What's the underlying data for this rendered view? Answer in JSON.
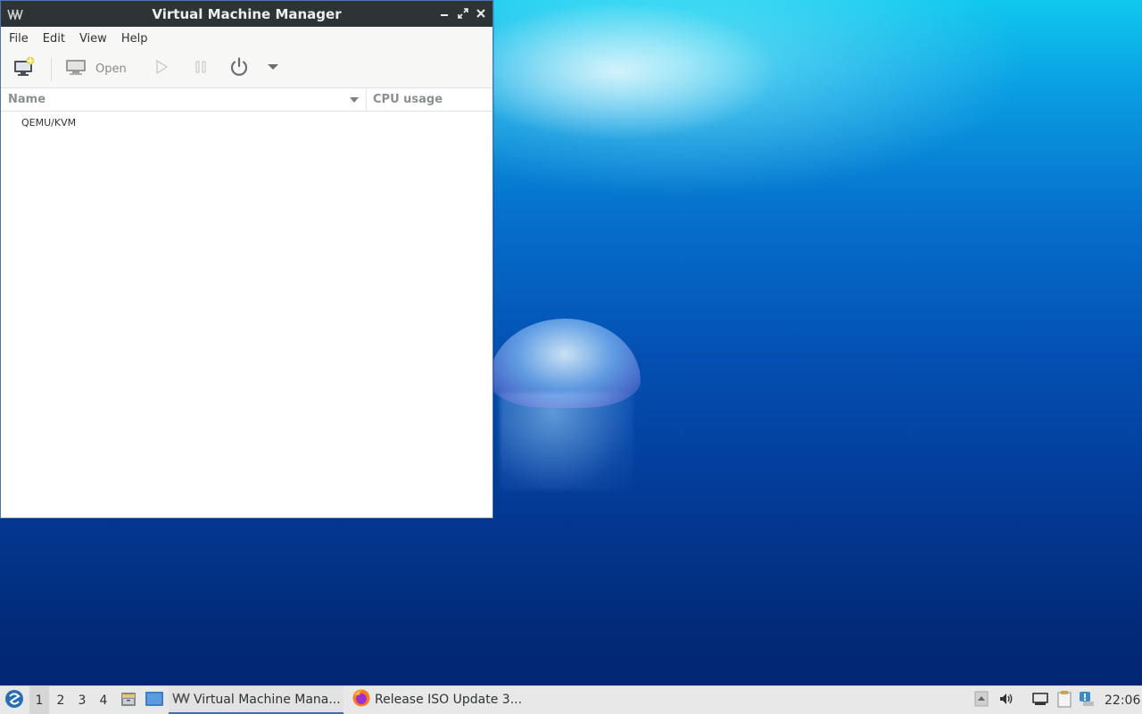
{
  "window": {
    "title": "Virtual Machine Manager",
    "app_icon_text": "VM"
  },
  "menubar": {
    "items": [
      "File",
      "Edit",
      "View",
      "Help"
    ]
  },
  "toolbar": {
    "open_label": "Open"
  },
  "table": {
    "columns": [
      "Name",
      "CPU usage"
    ],
    "rows": [
      {
        "name": "QEMU/KVM",
        "cpu": ""
      }
    ]
  },
  "taskbar": {
    "workspaces": [
      "1",
      "2",
      "3",
      "4"
    ],
    "active_workspace": "1",
    "tasks": [
      {
        "label": "Virtual Machine Mana...",
        "icon": "virt-manager-icon",
        "active": true
      },
      {
        "label": "Release ISO Update 3...",
        "icon": "firefox-icon",
        "active": false
      }
    ],
    "clock": "22:06"
  },
  "colors": {
    "accent": "#3d6fb6",
    "titlebar": "#2e3436",
    "window_border": "#4a78b4"
  }
}
